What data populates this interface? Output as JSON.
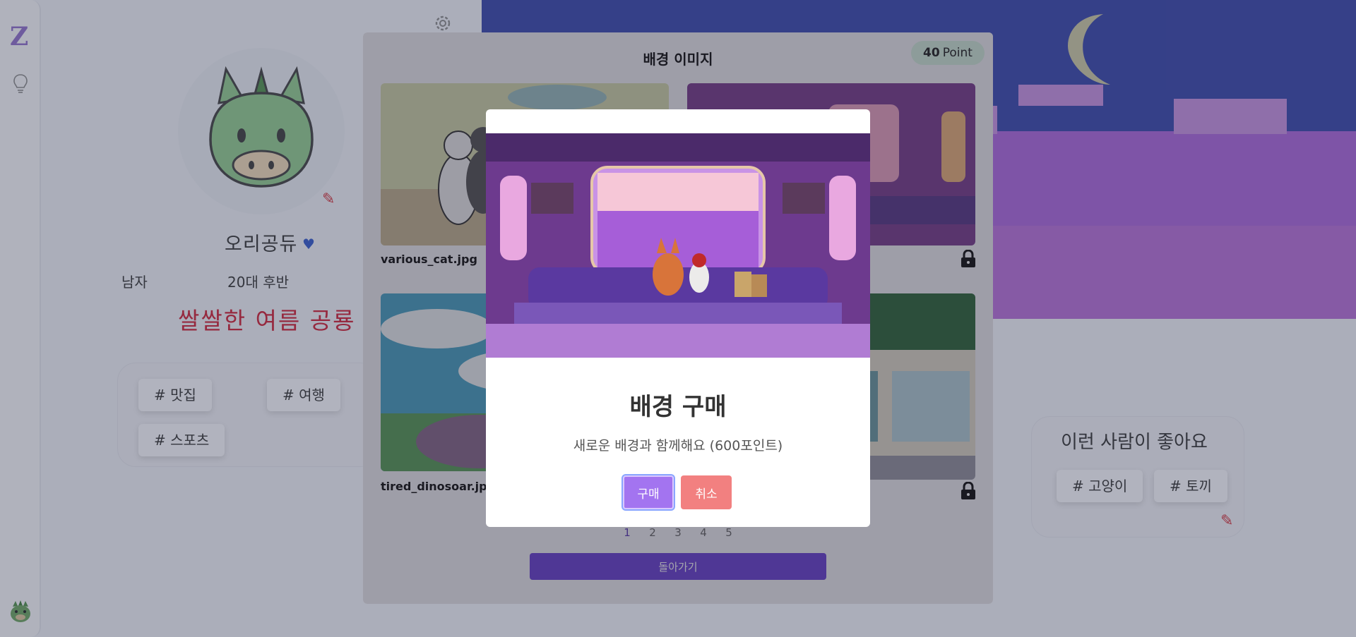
{
  "app": {
    "logo_letter": "Z"
  },
  "profile": {
    "name": "오리공듀",
    "gender": "남자",
    "age": "20대 후반",
    "tagline": "쌀쌀한 여름 공룡",
    "interests": [
      "# 맛집",
      "# 여행",
      "# 스포츠"
    ]
  },
  "preferences": {
    "title": "이런 사람이 좋아요",
    "tags": [
      "# 고양이",
      "# 토끼"
    ]
  },
  "background_picker": {
    "title": "배경 이미지",
    "points_value": "40",
    "points_unit": "Point",
    "images": [
      {
        "filename": "various_cat.jpg",
        "locked": false
      },
      {
        "filename": "",
        "locked": true
      },
      {
        "filename": "tired_dinosoar.jpg",
        "locked": false
      },
      {
        "filename": "",
        "locked": true
      }
    ],
    "pages": [
      "1",
      "2",
      "3",
      "4",
      "5"
    ],
    "current_page": "1",
    "back_label": "돌아가기"
  },
  "purchase_dialog": {
    "title": "배경 구매",
    "message": "새로운 배경과 함께해요 (600포인트)",
    "buy_label": "구매",
    "cancel_label": "취소"
  },
  "colors": {
    "accent": "#6c43d6",
    "buy": "#a374f0",
    "cancel": "#f28080",
    "tagline": "#cb1f35",
    "point_badge": "#d6efdf"
  },
  "icons": [
    "gear-icon",
    "bulb-icon",
    "heart-icon",
    "pencil-icon",
    "lock-icon",
    "dinosaur-avatar-icon"
  ]
}
